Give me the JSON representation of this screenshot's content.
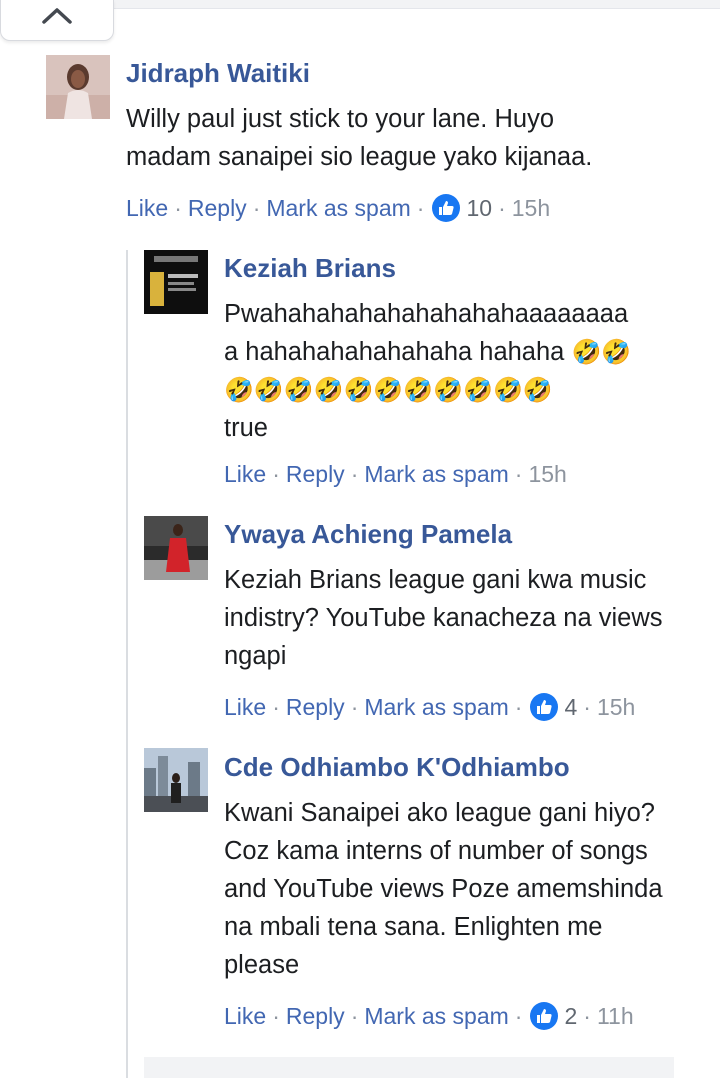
{
  "colors": {
    "author": "#385898",
    "link": "#4267b2",
    "meta": "#8d949e",
    "like": "#1877f2"
  },
  "comments": [
    {
      "author": "Jidraph Waitiki",
      "text": "Willy paul just stick to your lane. Huyo madam sanaipei sio league yako kijanaa.",
      "actions": {
        "like": "Like",
        "reply": "Reply",
        "spam": "Mark as spam",
        "sep": "·"
      },
      "likes": "10",
      "time": "15h"
    },
    {
      "author": "Keziah Brians",
      "text_line1": "Pwahahahahahahahahahaaaaaaaa",
      "text_line2": "a hahahahahahahaha hahaha",
      "emoji_row1": "🤣🤣",
      "emoji_row2": "🤣🤣🤣🤣🤣🤣🤣🤣🤣🤣🤣",
      "text_line4": "true",
      "actions": {
        "like": "Like",
        "reply": "Reply",
        "spam": "Mark as spam",
        "sep": "·"
      },
      "time": "15h"
    },
    {
      "author": "Ywaya Achieng Pamela",
      "text": "Keziah Brians league gani kwa music indistry? YouTube kanacheza na views ngapi",
      "actions": {
        "like": "Like",
        "reply": "Reply",
        "spam": "Mark as spam",
        "sep": "·"
      },
      "likes": "4",
      "time": "15h"
    },
    {
      "author": "Cde Odhiambo K'Odhiambo",
      "text": "Kwani Sanaipei ako league gani hiyo? Coz kama interns of number of songs and YouTube views Poze amemshinda na mbali tena sana. Enlighten me please",
      "actions": {
        "like": "Like",
        "reply": "Reply",
        "spam": "Mark as spam",
        "sep": "·"
      },
      "likes": "2",
      "time": "11h"
    }
  ]
}
